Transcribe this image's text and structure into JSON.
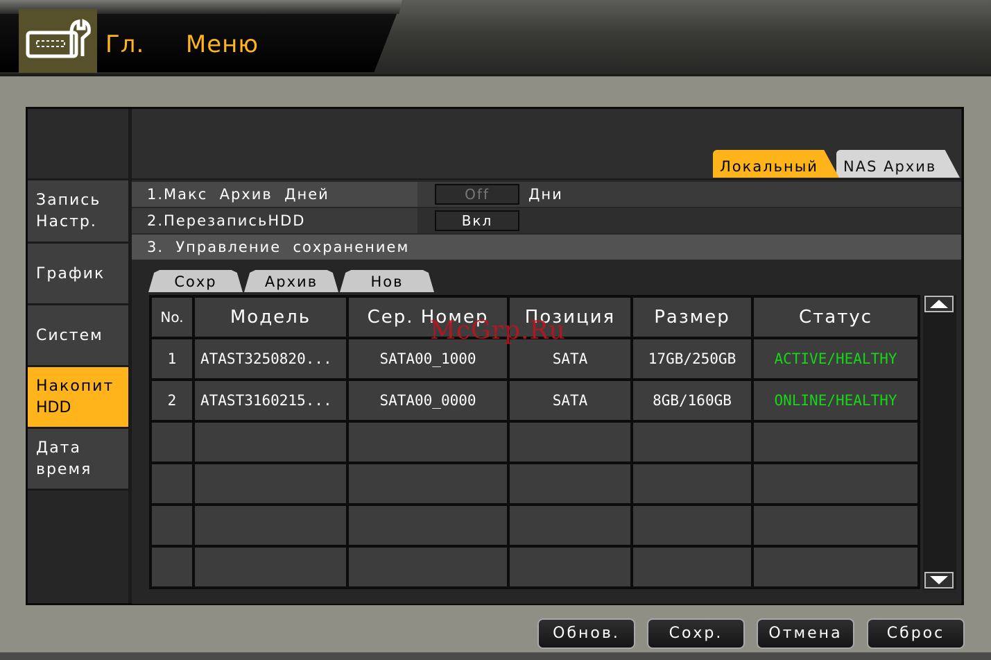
{
  "header": {
    "title": "Гл.  Меню",
    "icon": "settings-tool-icon"
  },
  "sidebar": {
    "items": [
      {
        "label_line1": "Запись",
        "label_line2": "Настр."
      },
      {
        "label_line1": "График",
        "label_line2": ""
      },
      {
        "label_line1": "Систем",
        "label_line2": ""
      },
      {
        "label_line1": "Накопит",
        "label_line2": "HDD"
      },
      {
        "label_line1": "Дата",
        "label_line2": "время"
      }
    ],
    "active_index": 3
  },
  "tabs": {
    "local": "Локальный",
    "nas": "NAS  Архив"
  },
  "options": {
    "max_archive_label": "1.Макс  Архив  Дней",
    "max_archive_value": "Off",
    "max_archive_unit": "Дни",
    "overwrite_label": "2.ПерезаписьHDD",
    "overwrite_value": "Вкл",
    "storage_mgmt_label": "3.  Управление  сохранением"
  },
  "subtabs": {
    "save": "Сохр",
    "archive": "Архив",
    "new": "Нов"
  },
  "table": {
    "headers": [
      "No.",
      "Модель",
      "Сер.  Номер",
      "Позиция",
      "Размер",
      "Статус"
    ],
    "rows": [
      {
        "no": "1",
        "model": "ATAST3250820...",
        "serial": "SATA00_1000",
        "position": "SATA",
        "size": "17GB/250GB",
        "status": "ACTIVE/HEALTHY"
      },
      {
        "no": "2",
        "model": "ATAST3160215...",
        "serial": "SATA00_0000",
        "position": "SATA",
        "size": "8GB/160GB",
        "status": "ONLINE/HEALTHY"
      }
    ],
    "status_color": "#17d617"
  },
  "watermark": "McGrp.Ru",
  "buttons": {
    "refresh": "Обнов.",
    "save": "Сохр.",
    "cancel": "Отмена",
    "reset": "Сброс"
  },
  "colors": {
    "accent": "#ffb41c",
    "panel": "#3d3d3d"
  }
}
